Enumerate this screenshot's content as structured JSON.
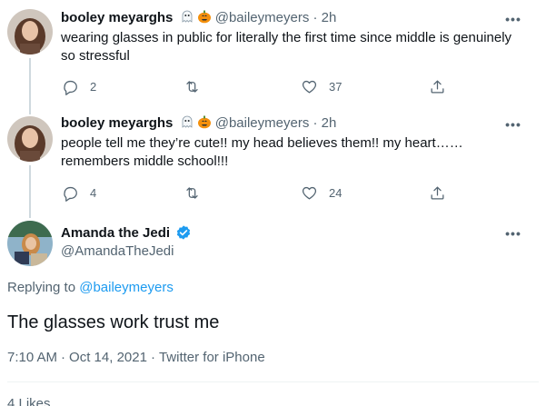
{
  "tweets": [
    {
      "name": "booley meyarghs",
      "handle": "@baileymeyers",
      "sep": "·",
      "time": "2h",
      "text": "wearing glasses in public for literally the first time since middle is genuinely so stressful",
      "replies": "2",
      "retweets": "",
      "likes": "37"
    },
    {
      "name": "booley meyarghs",
      "handle": "@baileymeyers",
      "sep": "·",
      "time": "2h",
      "text": "people tell me they’re cute!! my head believes them!! my heart…… remembers middle school!!!",
      "replies": "4",
      "retweets": "",
      "likes": "24"
    }
  ],
  "focused": {
    "name": "Amanda the Jedi",
    "handle": "@AmandaTheJedi",
    "replying_prefix": "Replying to",
    "replying_handle": "@baileymeyers",
    "text": "The glasses work trust me",
    "time": "7:10 AM",
    "sep1": "·",
    "date": "Oct 14, 2021",
    "sep2": "·",
    "source": "Twitter for iPhone",
    "likes_text": "4 Likes"
  },
  "more_label": "•••",
  "colors": {
    "accent": "#1d9bf0",
    "secondary": "#536471",
    "primary_text": "#0f1419",
    "line": "#cfd9de"
  }
}
